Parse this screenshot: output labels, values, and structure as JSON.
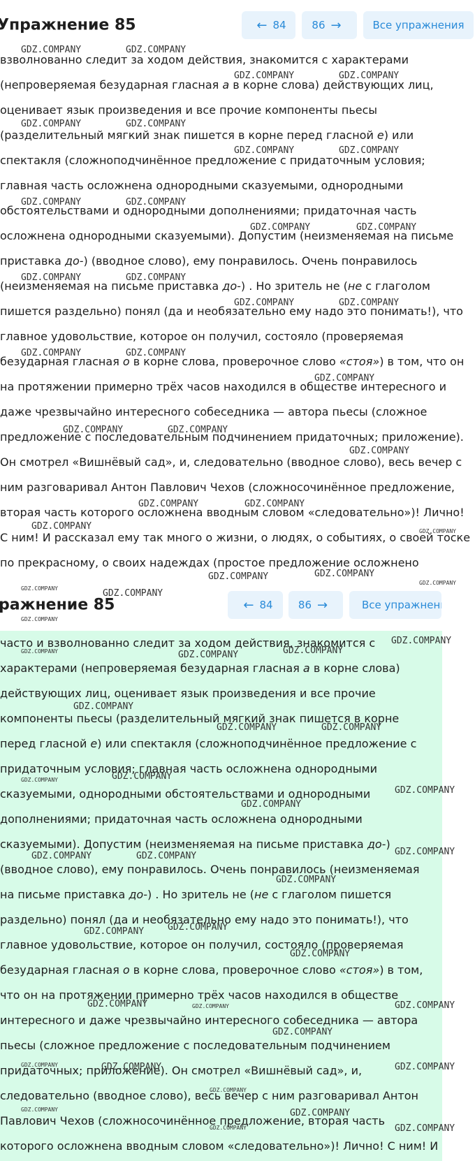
{
  "header1": {
    "title": "Упражнение 85",
    "prev_label": "84",
    "next_label": "86",
    "all_label": "Все упражнения"
  },
  "header2": {
    "title": "ражнение 85",
    "prev_label": "84",
    "next_label": "86",
    "all_label": "Все упражнени"
  },
  "watermark": "GDZ.COMPANY",
  "text1_lines": [
    "взволнованно следит за ходом действия, знакомится с характерами",
    "(непроверяемая безударная гласная <i>а</i> в корне слова) действующих лиц,",
    "оценивает язык произведения и все прочие компоненты пьесы",
    "(разделительный мягкий знак пишется в корне перед гласной <i>е</i>) или",
    "спектакля (сложноподчинённое предложение с придаточным условия;",
    "главная часть осложнена однородными сказуемыми, однородными",
    "обстоятельствами и однородными дополнениями; придаточная часть",
    "осложнена однородными сказуемыми). Допустим (неизменяемая на письме",
    "приставка <i>до-</i>) (вводное слово), ему понравилось. Очень понравилось",
    "(неизменяемая на письме приставка <i>до-</i>) . Но зритель не (<i>не</i> с глаголом",
    "пишется раздельно) понял (да и необязательно ему надо это понимать!), что",
    "главное удовольствие, которое он получил, состояло (проверяемая",
    "безударная гласная <i>о</i> в корне слова, проверочное слово <i>«стоя»</i>) в том, что он",
    "на протяжении примерно трёх часов находился в обществе интересного и",
    "даже чрезвычайно интересного собеседника — автора пьесы (сложное",
    "предложение с последовательным подчинением придаточных; приложение).",
    "Он смотрел «Вишнёвый сад», и, следовательно (вводное слово), весь вечер с",
    "ним разговаривал Антон Павлович Чехов (сложносочинённое предложение,",
    "вторая часть которого осложнена вводным словом «следовательно»)! Лично!",
    "С ним! И рассказал ему так много о жизни, о людях, о событиях, о своей тоске",
    "по прекрасному, о своих надеждах (простое предложение осложнено"
  ],
  "text2_lines": [
    "часто и взволнованно следит за ходом действия, знакомится с",
    "характерами (непроверяемая безударная гласная <i>а</i> в корне слова)",
    "действующих лиц, оценивает язык произведения и все прочие",
    "компоненты пьесы (разделительный мягкий знак пишется в корне",
    "перед гласной <i>е</i>) или спектакля (сложноподчинённое предложение с",
    "придаточным условия; главная часть осложнена однородными",
    "сказуемыми, однородными обстоятельствами и однородными",
    "дополнениями; придаточная часть осложнена однородными",
    "сказуемыми). Допустим (неизменяемая на письме приставка <i>до-</i>)",
    "(вводное слово), ему понравилось. Очень понравилось (неизменяемая",
    "на письме приставка <i>до-</i>) . Но зритель не (<i>не</i> с глаголом пишется",
    "раздельно) понял (да и необязательно ему надо это понимать!), что",
    "главное удовольствие, которое он получил, состояло (проверяемая",
    "безударная гласная <i>о</i> в корне слова, проверочное слово <i>«стоя»</i>) в том,",
    "что он на протяжении примерно трёх часов находился в обществе",
    "интересного и даже чрезвычайно интересного собеседника — автора",
    "пьесы (сложное предложение с последовательным подчинением",
    "придаточных; приложение). Он смотрел «Вишнёвый сад», и,",
    "следовательно (вводное слово), весь вечер с ним разговаривал Антон",
    "Павлович Чехов (сложносочинённое предложение, вторая часть",
    "которого осложнена вводным словом «следовательно»)! Лично! С ним! И"
  ]
}
